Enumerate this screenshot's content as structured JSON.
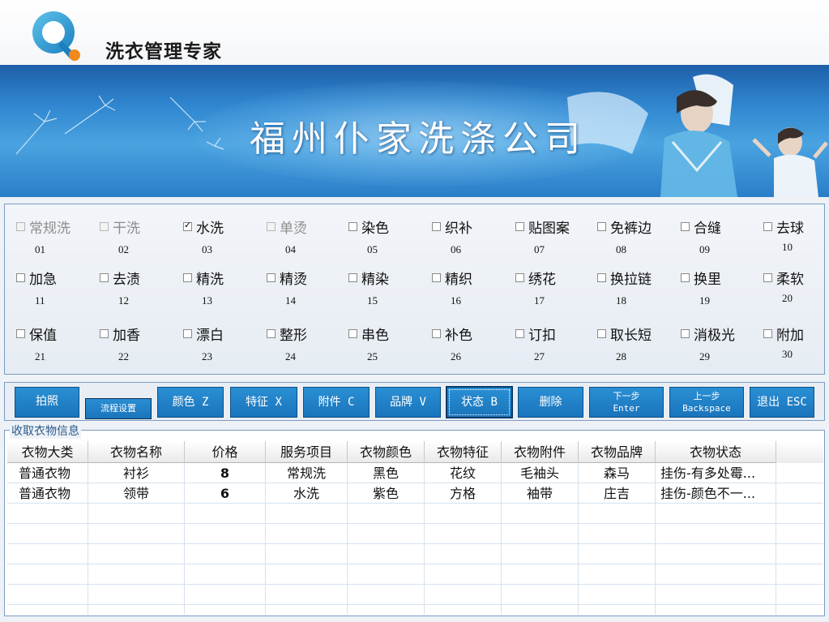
{
  "app": {
    "title": "洗衣管理专家"
  },
  "banner": {
    "company": "福州仆家洗涤公司"
  },
  "options": [
    {
      "label": "常规洗",
      "code": "01",
      "checked": false,
      "disabled": true
    },
    {
      "label": "干洗",
      "code": "02",
      "checked": false,
      "disabled": true
    },
    {
      "label": "水洗",
      "code": "03",
      "checked": true,
      "disabled": false
    },
    {
      "label": "单烫",
      "code": "04",
      "checked": false,
      "disabled": true
    },
    {
      "label": "染色",
      "code": "05",
      "checked": false,
      "disabled": false
    },
    {
      "label": "织补",
      "code": "06",
      "checked": false,
      "disabled": false
    },
    {
      "label": "贴图案",
      "code": "07",
      "checked": false,
      "disabled": false
    },
    {
      "label": "免裤边",
      "code": "08",
      "checked": false,
      "disabled": false
    },
    {
      "label": "合缝",
      "code": "09",
      "checked": false,
      "disabled": false
    },
    {
      "label": "去球",
      "code": "10",
      "checked": false,
      "disabled": false
    },
    {
      "label": "加急",
      "code": "11",
      "checked": false,
      "disabled": false
    },
    {
      "label": "去渍",
      "code": "12",
      "checked": false,
      "disabled": false
    },
    {
      "label": "精洗",
      "code": "13",
      "checked": false,
      "disabled": false
    },
    {
      "label": "精烫",
      "code": "14",
      "checked": false,
      "disabled": false
    },
    {
      "label": "精染",
      "code": "15",
      "checked": false,
      "disabled": false
    },
    {
      "label": "精织",
      "code": "16",
      "checked": false,
      "disabled": false
    },
    {
      "label": "绣花",
      "code": "17",
      "checked": false,
      "disabled": false
    },
    {
      "label": "换拉链",
      "code": "18",
      "checked": false,
      "disabled": false
    },
    {
      "label": "换里",
      "code": "19",
      "checked": false,
      "disabled": false
    },
    {
      "label": "柔软",
      "code": "20",
      "checked": false,
      "disabled": false
    },
    {
      "label": "保值",
      "code": "21",
      "checked": false,
      "disabled": false
    },
    {
      "label": "加香",
      "code": "22",
      "checked": false,
      "disabled": false
    },
    {
      "label": "漂白",
      "code": "23",
      "checked": false,
      "disabled": false
    },
    {
      "label": "整形",
      "code": "24",
      "checked": false,
      "disabled": false
    },
    {
      "label": "串色",
      "code": "25",
      "checked": false,
      "disabled": false
    },
    {
      "label": "补色",
      "code": "26",
      "checked": false,
      "disabled": false
    },
    {
      "label": "订扣",
      "code": "27",
      "checked": false,
      "disabled": false
    },
    {
      "label": "取长短",
      "code": "28",
      "checked": false,
      "disabled": false
    },
    {
      "label": "消极光",
      "code": "29",
      "checked": false,
      "disabled": false
    },
    {
      "label": "附加",
      "code": "30",
      "checked": false,
      "disabled": false
    }
  ],
  "toolbar": {
    "photo": "拍照",
    "flow_settings": "流程设置",
    "color": "颜色 Z",
    "feature": "特征 X",
    "accessory": "附件 C",
    "brand": "品牌 V",
    "status": "状态 B",
    "delete": "删除",
    "next_top": "下一步",
    "next_bottom": "Enter",
    "prev_top": "上一步",
    "prev_bottom": "Backspace",
    "exit": "退出 ESC"
  },
  "info": {
    "legend": "收取衣物信息",
    "columns": [
      "衣物大类",
      "衣物名称",
      "价格",
      "服务项目",
      "衣物颜色",
      "衣物特征",
      "衣物附件",
      "衣物品牌",
      "衣物状态"
    ],
    "rows": [
      [
        "普通衣物",
        "衬衫",
        "8",
        "常规洗",
        "黑色",
        "花纹",
        "毛袖头",
        "森马",
        "挂伤-有多处霉..."
      ],
      [
        "普通衣物",
        "领带",
        "6",
        "水洗",
        "紫色",
        "方格",
        "袖带",
        "庄吉",
        "挂伤-颜色不一..."
      ]
    ]
  }
}
